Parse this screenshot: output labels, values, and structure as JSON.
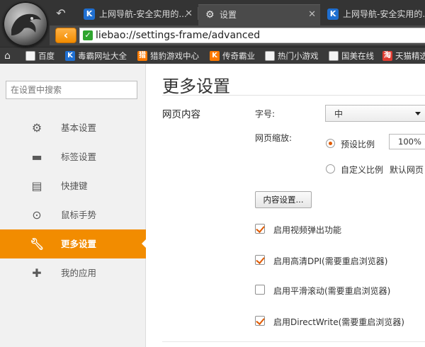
{
  "browser": {
    "tabs": [
      {
        "title": "上网导航-安全实用的...",
        "active": false
      },
      {
        "title": "设置",
        "active": true
      },
      {
        "title": "上网导航-安全实用的...",
        "active": false
      }
    ],
    "address": "liebao://settings-frame/advanced",
    "bookmarks": [
      {
        "label": "百度",
        "icon": "page"
      },
      {
        "label": "毒霸网址大全",
        "icon": "blue"
      },
      {
        "label": "猎豹游戏中心",
        "icon": "orange"
      },
      {
        "label": "传奇霸业",
        "icon": "orange"
      },
      {
        "label": "热门小游戏",
        "icon": "page"
      },
      {
        "label": "国美在线",
        "icon": "page"
      },
      {
        "label": "天猫精选",
        "icon": "red"
      }
    ]
  },
  "sidebar": {
    "search_placeholder": "在设置中搜索",
    "items": [
      {
        "label": "基本设置",
        "icon": "gear-icon",
        "active": false
      },
      {
        "label": "标签设置",
        "icon": "tab-icon",
        "active": false
      },
      {
        "label": "快捷键",
        "icon": "keyboard-icon",
        "active": false
      },
      {
        "label": "鼠标手势",
        "icon": "mouse-icon",
        "active": false
      },
      {
        "label": "更多设置",
        "icon": "wrench-icon",
        "active": true
      },
      {
        "label": "我的应用",
        "icon": "puzzle-icon",
        "active": false
      }
    ]
  },
  "main": {
    "title": "更多设置",
    "section": "网页内容",
    "font_size_label": "字号:",
    "font_size_value": "中",
    "zoom_label": "网页缩放:",
    "zoom_preset_label": "预设比例",
    "zoom_preset_value": "100%",
    "zoom_custom_label": "自定义比例",
    "zoom_custom_hint": "默认网页",
    "content_settings_button": "内容设置...",
    "checkboxes": [
      {
        "label": "启用视频弹出功能",
        "checked": true
      },
      {
        "label": "启用高清DPI(需要重启浏览器)",
        "checked": true
      },
      {
        "label": "启用平滑滚动(需要重启浏览器)",
        "checked": false
      },
      {
        "label": "启用DirectWrite(需要重启浏览器)",
        "checked": true
      }
    ]
  },
  "colors": {
    "accent": "#f28c00",
    "check": "#e05a00"
  }
}
